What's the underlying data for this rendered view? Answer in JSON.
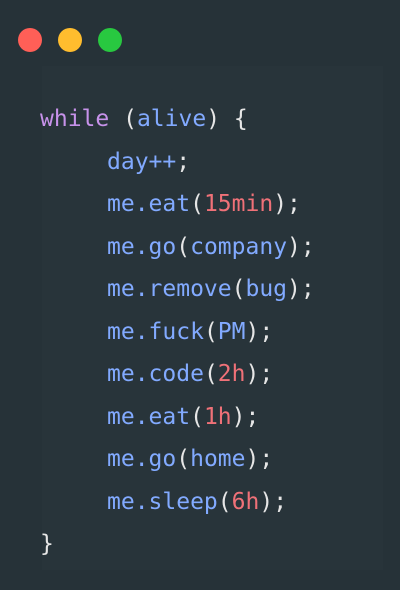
{
  "window": {
    "controls": [
      {
        "name": "close",
        "color": "#ff5f57"
      },
      {
        "name": "minimize",
        "color": "#ffbd2e"
      },
      {
        "name": "maximize",
        "color": "#28c840"
      }
    ]
  },
  "theme": {
    "background": "#263238",
    "keyword": "#c792ea",
    "identifier": "#82aaff",
    "number": "#f07178",
    "punctuation": "#e6e6e6"
  },
  "code": {
    "lines": [
      {
        "indent": 0,
        "tokens": [
          {
            "t": "while",
            "k": "kw"
          },
          {
            "t": " (",
            "k": "punc"
          },
          {
            "t": "alive",
            "k": "var"
          },
          {
            "t": ") {",
            "k": "punc"
          }
        ]
      },
      {
        "indent": 1,
        "tokens": [
          {
            "t": "day++",
            "k": "var"
          },
          {
            "t": ";",
            "k": "punc"
          }
        ]
      },
      {
        "indent": 1,
        "tokens": [
          {
            "t": "me.eat",
            "k": "var"
          },
          {
            "t": "(",
            "k": "punc"
          },
          {
            "t": "15min",
            "k": "num"
          },
          {
            "t": ");",
            "k": "punc"
          }
        ]
      },
      {
        "indent": 1,
        "tokens": [
          {
            "t": "me.go",
            "k": "var"
          },
          {
            "t": "(",
            "k": "punc"
          },
          {
            "t": "company",
            "k": "var"
          },
          {
            "t": ");",
            "k": "punc"
          }
        ]
      },
      {
        "indent": 1,
        "tokens": [
          {
            "t": "me.remove",
            "k": "var"
          },
          {
            "t": "(",
            "k": "punc"
          },
          {
            "t": "bug",
            "k": "var"
          },
          {
            "t": ");",
            "k": "punc"
          }
        ]
      },
      {
        "indent": 1,
        "tokens": [
          {
            "t": "me.fuck",
            "k": "var"
          },
          {
            "t": "(",
            "k": "punc"
          },
          {
            "t": "PM",
            "k": "var"
          },
          {
            "t": ");",
            "k": "punc"
          }
        ]
      },
      {
        "indent": 1,
        "tokens": [
          {
            "t": "me.code",
            "k": "var"
          },
          {
            "t": "(",
            "k": "punc"
          },
          {
            "t": "2h",
            "k": "num"
          },
          {
            "t": ");",
            "k": "punc"
          }
        ]
      },
      {
        "indent": 1,
        "tokens": [
          {
            "t": "me.eat",
            "k": "var"
          },
          {
            "t": "(",
            "k": "punc"
          },
          {
            "t": "1h",
            "k": "num"
          },
          {
            "t": ");",
            "k": "punc"
          }
        ]
      },
      {
        "indent": 1,
        "tokens": [
          {
            "t": "me.go",
            "k": "var"
          },
          {
            "t": "(",
            "k": "punc"
          },
          {
            "t": "home",
            "k": "var"
          },
          {
            "t": ");",
            "k": "punc"
          }
        ]
      },
      {
        "indent": 1,
        "tokens": [
          {
            "t": "me.sleep",
            "k": "var"
          },
          {
            "t": "(",
            "k": "punc"
          },
          {
            "t": "6h",
            "k": "num"
          },
          {
            "t": ");",
            "k": "punc"
          }
        ]
      },
      {
        "indent": 0,
        "tokens": [
          {
            "t": "}",
            "k": "punc"
          }
        ]
      }
    ]
  }
}
